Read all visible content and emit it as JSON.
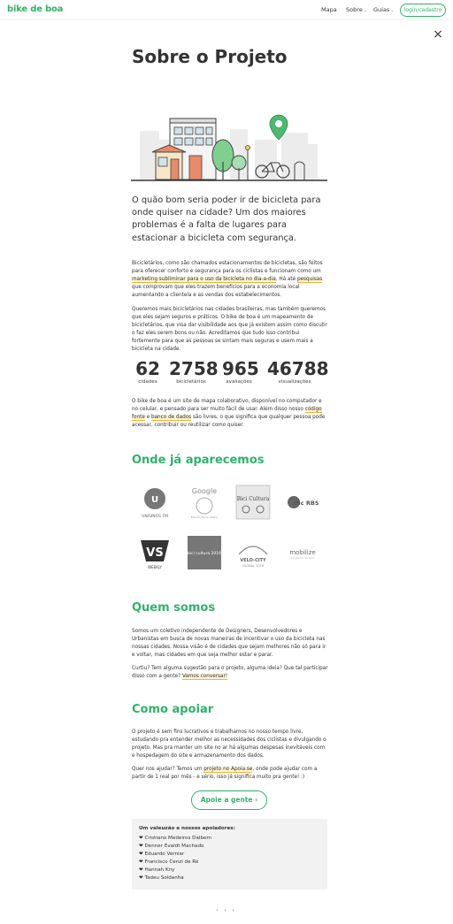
{
  "navbar": {
    "brand": "bike de boa",
    "links": [
      {
        "label": "Mapa"
      },
      {
        "label": "Sobre",
        "chevron": "⌄"
      },
      {
        "label": "Guias",
        "chevron": "⌄"
      }
    ],
    "login_label": "login/cadastro"
  },
  "close_icon": "×",
  "page_title": "Sobre o Projeto",
  "lead": "O quão bom seria poder ir de bicicleta para onde quiser na cidade? Um dos maiores problemas é a falta de lugares para estacionar a bicicleta com segurança.",
  "para1": {
    "t1": "Bicicletários, como são chamados estacionamentos de bicicletas, são feitos para oferecer conforto e segurança para os ciclistas e funcionam como um ",
    "link1": "marketing subliminar para o uso da bicicleta no dia-a-dia",
    "t2": ". Há até ",
    "link2": "pesquisas",
    "t3": " que comprovam que eles trazem benefícios para a economia local aumentando a clientela e as vendas dos estabelecimentos."
  },
  "para2": "Queremos mais bicicletários nas cidades brasileiras, mas também queremos que eles sejam seguros e práticos. O bike de boa é um mapeamento de bicicletários, que visa dar visibilidade aos que já existem assim como discutir o faz eles serem bons ou não. Acreditamos que tudo isso contribui fortemente para que as pessoas se sintam mais seguras e usem mais a bicicleta na cidade.",
  "stats": [
    {
      "value": "62",
      "label": "cidades"
    },
    {
      "value": "2758",
      "label": "bicicletários"
    },
    {
      "value": "965",
      "label": "avaliações"
    },
    {
      "value": "46788",
      "label": "visualizações"
    }
  ],
  "para3": {
    "t1": "O bike de boa é um site de mapa colaborativo, disponível no computador e no celular, e pensado para ser muito fácil de usar. Além disso nosso ",
    "link1": "código fonte",
    "t2": " e ",
    "link2": "banco de dados",
    "t3": " são livres, o que significa que qualquer pessoa pode acessar, contribuir ou reutilizar como quiser."
  },
  "press": {
    "title": "Onde já aparecemos",
    "logos": [
      {
        "name": "unisinos-fm-logo",
        "text": "UNISINOS FM"
      },
      {
        "name": "google-logo",
        "text": "Google",
        "sub": "Estúdio Porto Alegre"
      },
      {
        "name": "bici-cultura-logo",
        "text": "Bici Cultura"
      },
      {
        "name": "clic-rbs-logo",
        "text": "clic RBS"
      },
      {
        "name": "vs-weekly-logo",
        "text": "VS",
        "sub": "WEEKLY"
      },
      {
        "name": "bicicultura-2016-logo",
        "text": "bici cultura 2016"
      },
      {
        "name": "velo-city-logo",
        "text": "VELO-CITY",
        "sub": "GLOBAL 2016"
      },
      {
        "name": "mobilize-logo",
        "text": "mobilize"
      }
    ]
  },
  "about": {
    "title": "Quem somos",
    "p1": "Somos um coletivo independente de Designers, Desenvolvedores e Urbanistas em busca de novas maneiras de incentivar o uso da bicicleta nas nossas cidades. Nossa visão é de cidades que sejam melhores não só para ir e voltar, mas cidades em que seja melhor estar e parar.",
    "p2_text": "Curtiu? Tem alguma sugestão para o projeto, alguma ideia? Que tal participar disso com a gente? ",
    "p2_link": "Vamos conversar!"
  },
  "support": {
    "title": "Como apoiar",
    "p1": "O projeto é sem fins lucrativos e trabalhamos no nosso tempo livre, estudando pra entender melhor as necessidades dos ciclistas e divulgando o projeto. Mas pra manter um site no ar há algumas despesas inevitáveis com e hospedagem do site e armazenamento dos dados.",
    "p2_t1": "Quer nos ajudar? Temos um ",
    "p2_link": "projeto no Apoia.se",
    "p2_t2": ", onde pode ajudar com a partir de 1 real por mês - e sério, isso já significa muito pra gente! :)",
    "button_label": "Apoie a gente ›"
  },
  "supporters": {
    "title": "Um valeuzão a nossos apoiadores:",
    "items": [
      "❤ Cristiano Medeiros Dalbem",
      "❤ Denner Evaldt Machado",
      "❤ Eduardo Vernier",
      "❤ Francisco Cenzi de Ré",
      "❤ Hannah Kny",
      "❤ Tadeu Soldanha"
    ]
  },
  "footer_dots": "· · ·",
  "colors": {
    "accent": "#2fb36a",
    "highlight": "#f2b62e"
  }
}
